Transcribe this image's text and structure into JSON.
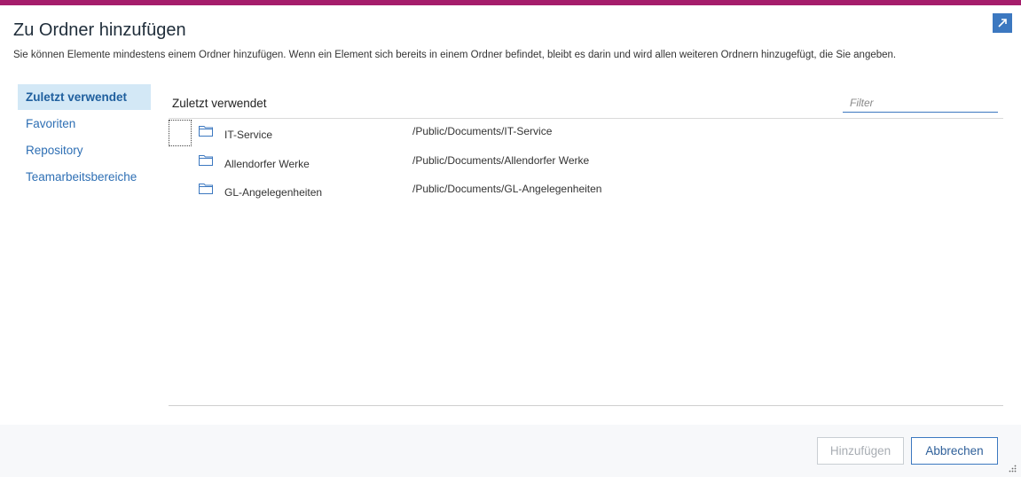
{
  "colors": {
    "accent_bar": "#a51d6b",
    "primary": "#3c78c0",
    "active_bg": "#d3e8f6"
  },
  "dialog": {
    "title": "Zu Ordner hinzufügen",
    "description": "Sie können Elemente mindestens einem Ordner hinzufügen. Wenn ein Element sich bereits in einem Ordner befindet, bleibt es darin und wird allen weiteren Ordnern hinzugefügt, die Sie angeben.",
    "expand_icon": "expand-icon"
  },
  "sidebar": {
    "items": [
      {
        "label": "Zuletzt verwendet",
        "active": true
      },
      {
        "label": "Favoriten",
        "active": false
      },
      {
        "label": "Repository",
        "active": false
      },
      {
        "label": "Teamarbeitsbereiche",
        "active": false
      }
    ]
  },
  "content": {
    "header": "Zuletzt verwendet",
    "filter_placeholder": "Filter",
    "rows": [
      {
        "name": "IT-Service",
        "path": "/Public/Documents/IT-Service",
        "icon": "folder-icon"
      },
      {
        "name": "Allendorfer Werke",
        "path": "/Public/Documents/Allendorfer Werke",
        "icon": "folder-icon"
      },
      {
        "name": "GL-Angelegenheiten",
        "path": "/Public/Documents/GL-Angelegenheiten",
        "icon": "folder-icon"
      }
    ]
  },
  "footer": {
    "add_label": "Hinzufügen",
    "add_disabled": true,
    "cancel_label": "Abbrechen"
  }
}
